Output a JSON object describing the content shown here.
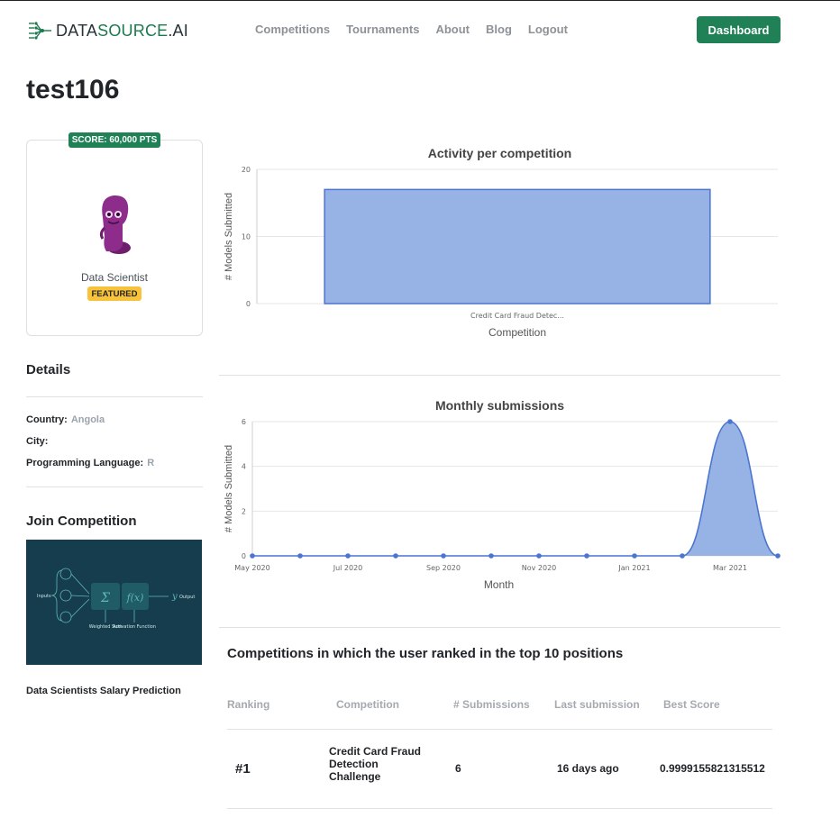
{
  "header": {
    "logo": {
      "prefix": "DATA",
      "accent": "SOURCE",
      "suffix": ".AI"
    },
    "nav": [
      "Competitions",
      "Tournaments",
      "About",
      "Blog",
      "Logout"
    ],
    "dashboard_label": "Dashboard"
  },
  "profile": {
    "username": "test106",
    "score_badge": "SCORE: 60,000 PTS",
    "role": "Data Scientist",
    "featured_badge": "FEATURED",
    "avatar_icon": "purple-character-avatar"
  },
  "details": {
    "title": "Details",
    "country_label": "Country:",
    "country_value": "Angola",
    "city_label": "City:",
    "city_value": "",
    "language_label": "Programming Language:",
    "language_value": "R"
  },
  "join": {
    "title": "Join Competition",
    "image_icon": "neural-network-diagram",
    "diagram_labels": {
      "inputs": "Inputs",
      "sum": "Σ",
      "fx": "f(x)",
      "y": "y",
      "output": "Output",
      "weighted_sum": "Weighted Sum",
      "activation": "Activation Function"
    },
    "caption": "Data Scientists Salary Prediction"
  },
  "colors": {
    "brand": "#1f8155",
    "badge": "#f8c33a",
    "chart_fill": "#97b3e6",
    "chart_line": "#4c75cf"
  },
  "chart_data": [
    {
      "type": "bar",
      "title": "Activity per competition",
      "xlabel": "Competition",
      "ylabel": "# Models Submitted",
      "categories": [
        "Credit Card Fraud Detec..."
      ],
      "values": [
        17
      ],
      "ylim": [
        0,
        20
      ],
      "yticks": [
        0,
        10,
        20
      ],
      "grid": true
    },
    {
      "type": "area",
      "title": "Monthly submissions",
      "xlabel": "Month",
      "ylabel": "# Models Submitted",
      "x": [
        "May 2020",
        "Jun 2020",
        "Jul 2020",
        "Aug 2020",
        "Sep 2020",
        "Oct 2020",
        "Nov 2020",
        "Dec 2020",
        "Jan 2021",
        "Feb 2021",
        "Mar 2021",
        "Apr 2021"
      ],
      "xtick_labels": [
        "May 2020",
        "Jul 2020",
        "Sep 2020",
        "Nov 2020",
        "Jan 2021",
        "Mar 2021"
      ],
      "values": [
        0,
        0,
        0,
        0,
        0,
        0,
        0,
        0,
        0,
        0,
        6,
        0
      ],
      "ylim": [
        0,
        6
      ],
      "yticks": [
        0,
        2,
        4,
        6
      ],
      "grid": true
    }
  ],
  "rankings": {
    "title": "Competitions in which the user ranked in the top 10 positions",
    "headers": [
      "Ranking",
      "Competition",
      "# Submissions",
      "Last submission",
      "Best Score"
    ],
    "rows": [
      {
        "rank": "#1",
        "competition": "Credit Card Fraud Detection Challenge",
        "submissions": "6",
        "last": "16 days ago",
        "score": "0.9999155821315512"
      }
    ]
  }
}
